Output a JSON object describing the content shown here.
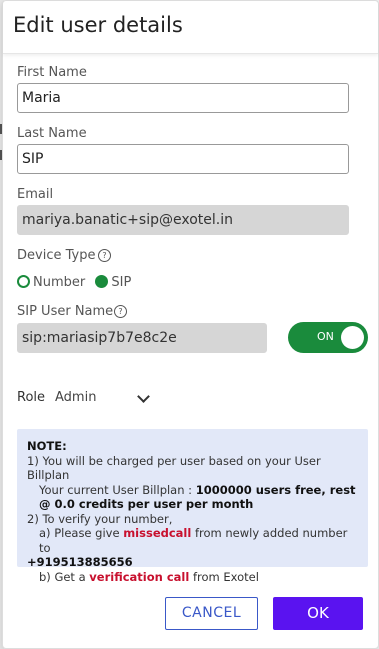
{
  "dialog": {
    "title": "Edit user details"
  },
  "fields": {
    "first_name": {
      "label": "First Name",
      "value": "Maria"
    },
    "last_name": {
      "label": "Last Name",
      "value": "SIP"
    },
    "email": {
      "label": "Email",
      "value": "mariya.banatic+sip@exotel.in"
    },
    "device_type": {
      "label": "Device Type",
      "options": [
        "Number",
        "SIP"
      ],
      "selected": "SIP"
    },
    "sip_user_name": {
      "label": "SIP User Name",
      "value": "sip:mariasip7b7e8c2e"
    },
    "toggle": {
      "label": "ON",
      "state": true
    },
    "role": {
      "label": "Role",
      "value": "Admin"
    }
  },
  "note": {
    "heading": "NOTE:",
    "line1": "1) You will be charged per user based on your User Billplan",
    "line2_prefix": "Your current User Billplan : ",
    "line2_bold": "1000000 users free, rest @ 0.0 credits per user per month",
    "line3": "2) To verify your number,",
    "line4_prefix": "a) Please give ",
    "line4_red": "missedcall",
    "line4_suffix": " from newly added number to",
    "line5_bold": "+919513885656",
    "line6_prefix": "b) Get a ",
    "line6_red": "verification call",
    "line6_suffix": " from Exotel"
  },
  "buttons": {
    "cancel": "CANCEL",
    "ok": "OK"
  },
  "colors": {
    "accent_green": "#1a8b3c",
    "primary_purple": "#5a13f0",
    "cancel_blue": "#3a58c8",
    "note_bg": "#e2e8f8",
    "highlight_red": "#c8102e"
  },
  "icons": {
    "help": "help-circle-icon",
    "chevron": "chevron-down-icon"
  }
}
